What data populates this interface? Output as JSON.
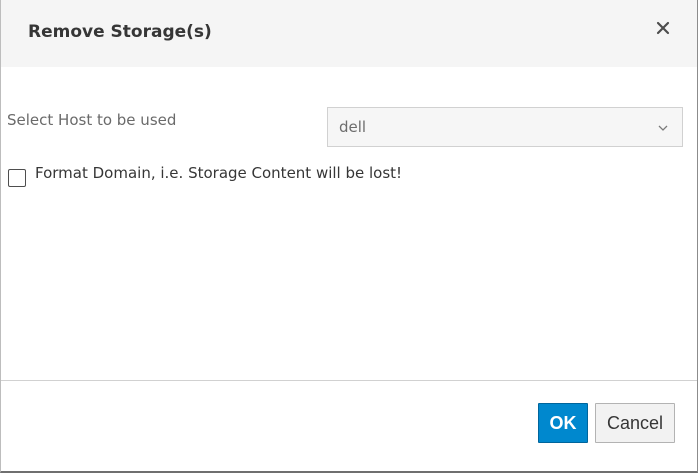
{
  "dialog": {
    "title": "Remove Storage(s)",
    "close_icon": "close-icon"
  },
  "form": {
    "host_label": "Select Host to be used",
    "host_selected": "dell",
    "chevron_icon": "chevron-down-icon",
    "format_checked": false,
    "format_label": "Format Domain, i.e. Storage Content will be lost!"
  },
  "footer": {
    "ok_label": "OK",
    "cancel_label": "Cancel"
  },
  "colors": {
    "primary": "#0088ce",
    "header_bg": "#f5f5f5"
  }
}
